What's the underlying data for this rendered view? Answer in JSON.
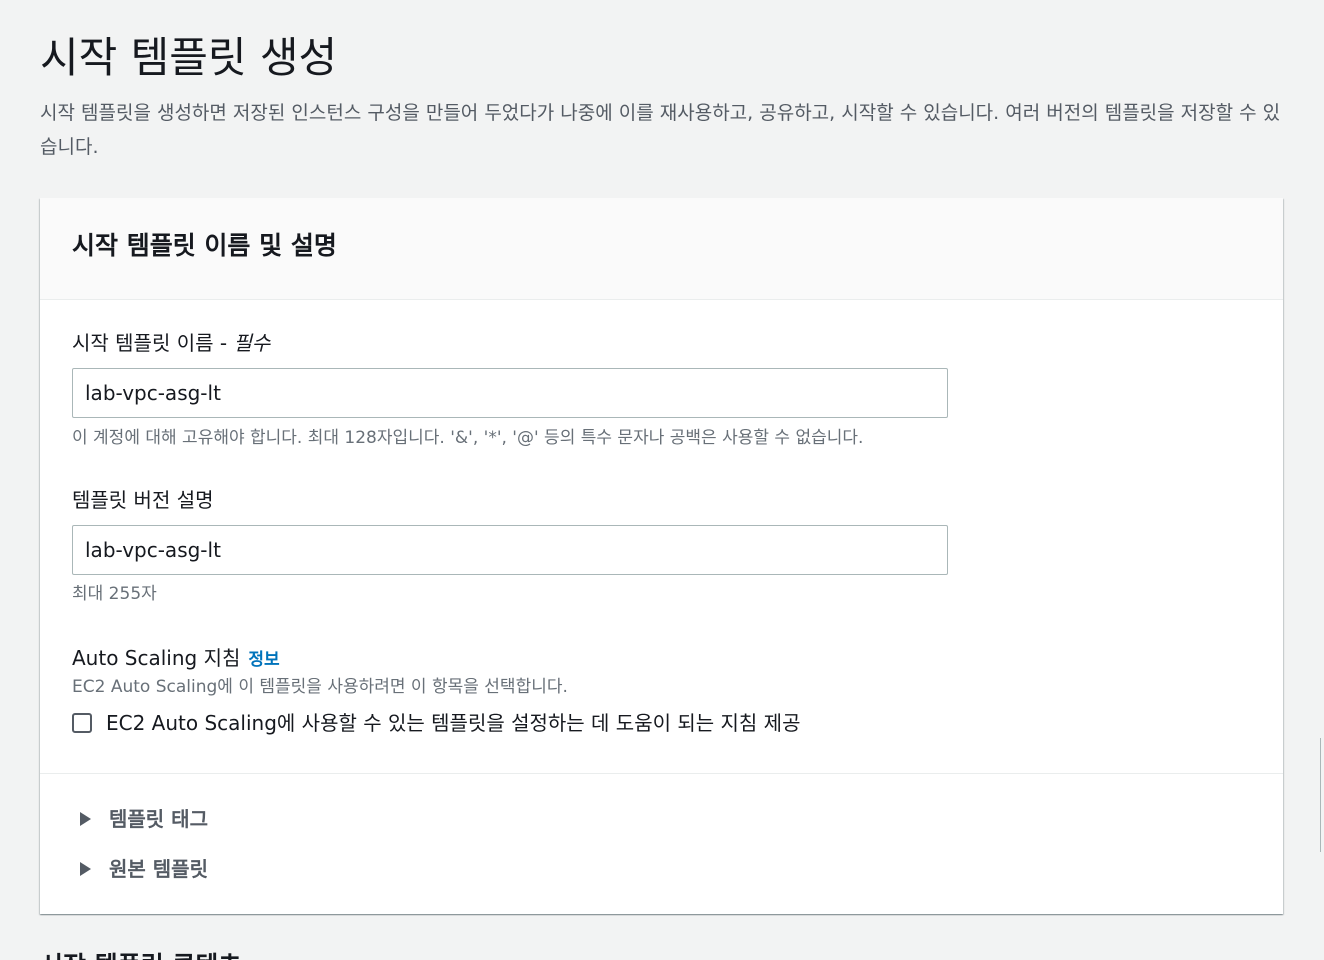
{
  "header": {
    "title": "시작 템플릿 생성",
    "description": "시작 템플릿을 생성하면 저장된 인스턴스 구성을 만들어 두었다가 나중에 이를 재사용하고, 공유하고, 시작할 수 있습니다. 여러 버전의 템플릿을 저장할 수 있습니다."
  },
  "name_section": {
    "title": "시작 템플릿 이름 및 설명",
    "template_name": {
      "label": "시작 템플릿 이름 - ",
      "required": "필수",
      "value": "lab-vpc-asg-lt",
      "hint": "이 계정에 대해 고유해야 합니다. 최대 128자입니다. '&', '*', '@' 등의 특수 문자나 공백은 사용할 수 없습니다."
    },
    "version_description": {
      "label": "템플릿 버전 설명",
      "value": "lab-vpc-asg-lt",
      "hint": "최대 255자"
    },
    "auto_scaling": {
      "label": "Auto Scaling 지침",
      "info_link": "정보",
      "description": "EC2 Auto Scaling에 이 템플릿을 사용하려면 이 항목을 선택합니다.",
      "checkbox_label": "EC2 Auto Scaling에 사용할 수 있는 템플릿을 설정하는 데 도움이 되는 지침 제공",
      "checked": false
    },
    "expanders": [
      {
        "label": "템플릿 태그"
      },
      {
        "label": "원본 템플릿"
      }
    ]
  },
  "next_section": {
    "title": "시작 템플릿 콘텐츠"
  }
}
